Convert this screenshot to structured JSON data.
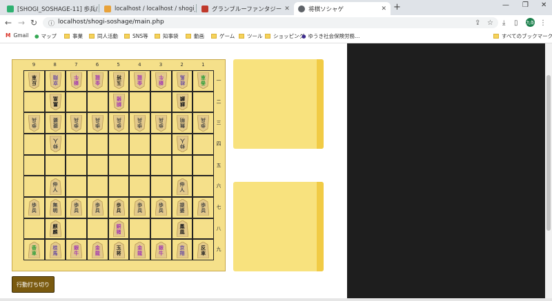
{
  "tabs": [
    {
      "title": "[SHOGI_SOSHAGE-11] 歩兵/駒…",
      "fav": "#2fb171",
      "active": false
    },
    {
      "title": "localhost / localhost / shogi_sos…",
      "fav": "#e8a23a",
      "active": false
    },
    {
      "title": "グランブルーファンタジー",
      "fav": "#c0392b",
      "active": false
    },
    {
      "title": "将棋ソシャゲ",
      "fav": "#5f6368",
      "active": true
    }
  ],
  "url": "localhost/shogi-soshage/main.php",
  "avatar_text": "九条",
  "bookmarks": [
    {
      "label": "Gmail",
      "icon": "gmail-icon"
    },
    {
      "label": "マップ",
      "icon": "maps-icon"
    },
    {
      "label": "事業",
      "icon": "folder-icon"
    },
    {
      "label": "同人活動",
      "icon": "folder-icon"
    },
    {
      "label": "SNS等",
      "icon": "folder-icon"
    },
    {
      "label": "知事袋",
      "icon": "folder-icon"
    },
    {
      "label": "動画",
      "icon": "folder-icon"
    },
    {
      "label": "ゲーム",
      "icon": "folder-icon"
    },
    {
      "label": "ツール",
      "icon": "folder-icon"
    },
    {
      "label": "ショッピング",
      "icon": "folder-icon"
    },
    {
      "label": "ゆうき社会保険労務…",
      "icon": "site-icon"
    }
  ],
  "all_bookmarks": "すべてのブックマーク",
  "board": {
    "col_labels": [
      "9",
      "8",
      "7",
      "6",
      "5",
      "4",
      "3",
      "2",
      "1"
    ],
    "row_labels": [
      "一",
      "二",
      "三",
      "四",
      "五",
      "六",
      "七",
      "八",
      "九"
    ],
    "pieces": [
      {
        "r": 0,
        "c": 0,
        "t": [
          "反",
          "車"
        ],
        "g": true,
        "col": "#222"
      },
      {
        "r": 0,
        "c": 1,
        "t": [
          "京",
          "翔"
        ],
        "g": true,
        "col": "#6b4fa0"
      },
      {
        "r": 0,
        "c": 2,
        "t": [
          "銀",
          "牛"
        ],
        "g": true,
        "col": "#a23ab0"
      },
      {
        "r": 0,
        "c": 3,
        "t": [
          "金",
          "龍"
        ],
        "g": true,
        "col": "#a23ab0"
      },
      {
        "r": 0,
        "c": 4,
        "t": [
          "玉",
          "将"
        ],
        "g": true,
        "col": "#222"
      },
      {
        "r": 0,
        "c": 5,
        "t": [
          "金",
          "龍"
        ],
        "g": true,
        "col": "#a23ab0"
      },
      {
        "r": 0,
        "c": 6,
        "t": [
          "銀",
          "牛"
        ],
        "g": true,
        "col": "#a23ab0"
      },
      {
        "r": 0,
        "c": 7,
        "t": [
          "桂",
          "馬"
        ],
        "g": true,
        "col": "#6b4fa0"
      },
      {
        "r": 0,
        "c": 8,
        "t": [
          "香",
          "車"
        ],
        "g": true,
        "col": "#2a9d3a"
      },
      {
        "r": 1,
        "c": 1,
        "t": [
          "鳳",
          "凰"
        ],
        "g": true,
        "col": "#222"
      },
      {
        "r": 1,
        "c": 4,
        "t": [
          "銅",
          "猪"
        ],
        "g": true,
        "col": "#a23ab0"
      },
      {
        "r": 1,
        "c": 7,
        "t": [
          "麒",
          "麟"
        ],
        "g": true,
        "col": "#222"
      },
      {
        "r": 2,
        "c": 0,
        "t": [
          "歩",
          "兵"
        ],
        "g": true,
        "col": "#444"
      },
      {
        "r": 2,
        "c": 1,
        "t": [
          "提",
          "婆"
        ],
        "g": true,
        "col": "#444"
      },
      {
        "r": 2,
        "c": 2,
        "t": [
          "歩",
          "兵"
        ],
        "g": true,
        "col": "#444"
      },
      {
        "r": 2,
        "c": 3,
        "t": [
          "歩",
          "兵"
        ],
        "g": true,
        "col": "#444"
      },
      {
        "r": 2,
        "c": 4,
        "t": [
          "歩",
          "兵"
        ],
        "g": true,
        "col": "#444"
      },
      {
        "r": 2,
        "c": 5,
        "t": [
          "歩",
          "兵"
        ],
        "g": true,
        "col": "#444"
      },
      {
        "r": 2,
        "c": 6,
        "t": [
          "歩",
          "兵"
        ],
        "g": true,
        "col": "#444"
      },
      {
        "r": 2,
        "c": 7,
        "t": [
          "無",
          "明"
        ],
        "g": true,
        "col": "#444"
      },
      {
        "r": 2,
        "c": 8,
        "t": [
          "歩",
          "兵"
        ],
        "g": true,
        "col": "#444"
      },
      {
        "r": 3,
        "c": 1,
        "t": [
          "仲",
          "人"
        ],
        "g": true,
        "col": "#444"
      },
      {
        "r": 3,
        "c": 7,
        "t": [
          "仲",
          "人"
        ],
        "g": true,
        "col": "#444"
      },
      {
        "r": 5,
        "c": 1,
        "t": [
          "仲",
          "人"
        ],
        "g": false,
        "col": "#444"
      },
      {
        "r": 5,
        "c": 7,
        "t": [
          "仲",
          "人"
        ],
        "g": false,
        "col": "#444"
      },
      {
        "r": 6,
        "c": 0,
        "t": [
          "歩",
          "兵"
        ],
        "g": false,
        "col": "#444"
      },
      {
        "r": 6,
        "c": 1,
        "t": [
          "無",
          "明"
        ],
        "g": false,
        "col": "#444"
      },
      {
        "r": 6,
        "c": 2,
        "t": [
          "歩",
          "兵"
        ],
        "g": false,
        "col": "#444"
      },
      {
        "r": 6,
        "c": 3,
        "t": [
          "歩",
          "兵"
        ],
        "g": false,
        "col": "#444"
      },
      {
        "r": 6,
        "c": 4,
        "t": [
          "歩",
          "兵"
        ],
        "g": false,
        "col": "#222"
      },
      {
        "r": 6,
        "c": 5,
        "t": [
          "歩",
          "兵"
        ],
        "g": false,
        "col": "#444"
      },
      {
        "r": 6,
        "c": 6,
        "t": [
          "歩",
          "兵"
        ],
        "g": false,
        "col": "#444"
      },
      {
        "r": 6,
        "c": 7,
        "t": [
          "提",
          "婆"
        ],
        "g": false,
        "col": "#444"
      },
      {
        "r": 6,
        "c": 8,
        "t": [
          "歩",
          "兵"
        ],
        "g": false,
        "col": "#444"
      },
      {
        "r": 7,
        "c": 1,
        "t": [
          "麒",
          "麟"
        ],
        "g": false,
        "col": "#222"
      },
      {
        "r": 7,
        "c": 4,
        "t": [
          "銅",
          "猪"
        ],
        "g": false,
        "col": "#a23ab0"
      },
      {
        "r": 7,
        "c": 7,
        "t": [
          "鳳",
          "凰"
        ],
        "g": false,
        "col": "#222"
      },
      {
        "r": 8,
        "c": 0,
        "t": [
          "香",
          "車"
        ],
        "g": false,
        "col": "#2a9d3a"
      },
      {
        "r": 8,
        "c": 1,
        "t": [
          "桂",
          "馬"
        ],
        "g": false,
        "col": "#6b4fa0"
      },
      {
        "r": 8,
        "c": 2,
        "t": [
          "銀",
          "牛"
        ],
        "g": false,
        "col": "#a23ab0"
      },
      {
        "r": 8,
        "c": 3,
        "t": [
          "金",
          "龍"
        ],
        "g": false,
        "col": "#a23ab0"
      },
      {
        "r": 8,
        "c": 4,
        "t": [
          "玉",
          "将"
        ],
        "g": false,
        "col": "#222"
      },
      {
        "r": 8,
        "c": 5,
        "t": [
          "金",
          "龍"
        ],
        "g": false,
        "col": "#a23ab0"
      },
      {
        "r": 8,
        "c": 6,
        "t": [
          "銀",
          "牛"
        ],
        "g": false,
        "col": "#a23ab0"
      },
      {
        "r": 8,
        "c": 7,
        "t": [
          "京",
          "翔"
        ],
        "g": false,
        "col": "#6b4fa0"
      },
      {
        "r": 8,
        "c": 8,
        "t": [
          "反",
          "車"
        ],
        "g": false,
        "col": "#222"
      }
    ]
  },
  "end_turn_button": "行動打ち切り"
}
